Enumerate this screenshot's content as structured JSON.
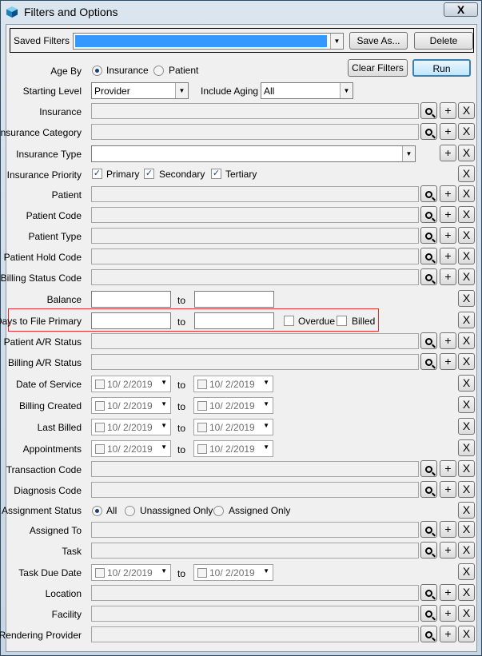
{
  "window": {
    "title": "Filters and Options",
    "close_label": "X"
  },
  "saved_filters": {
    "label": "Saved Filters",
    "value": "",
    "save_as": "Save As...",
    "delete": "Delete"
  },
  "buttons": {
    "clear_filters": "Clear Filters",
    "run": "Run"
  },
  "age_by": {
    "label": "Age By",
    "opt1": "Insurance",
    "opt2": "Patient"
  },
  "starting_level": {
    "label": "Starting Level",
    "value": "Provider"
  },
  "include_aging": {
    "label": "Include Aging",
    "value": "All"
  },
  "insurance_priority": {
    "label": "Insurance Priority",
    "opt1": "Primary",
    "opt2": "Secondary",
    "opt3": "Tertiary"
  },
  "to": "to",
  "days_to_file": {
    "overdue": "Overdue",
    "billed": "Billed"
  },
  "assignment_status": {
    "label": "Assignment Status",
    "opt1": "All",
    "opt2": "Unassigned Only",
    "opt3": "Assigned Only"
  },
  "date_value": "10/  2/2019",
  "icons": {
    "search": "search-icon",
    "add": "+",
    "remove": "X"
  },
  "labels": {
    "insurance": "Insurance",
    "insurance_category": "Insurance Category",
    "insurance_type": "Insurance Type",
    "patient": "Patient",
    "patient_code": "Patient Code",
    "patient_type": "Patient Type",
    "patient_hold_code": "Patient Hold Code",
    "billing_status_code": "Billing Status Code",
    "balance": "Balance",
    "days_to_file_primary": "Days to File Primary",
    "patient_ar_status": "Patient A/R Status",
    "billing_ar_status": "Billing A/R Status",
    "date_of_service": "Date of Service",
    "billing_created": "Billing Created",
    "last_billed": "Last Billed",
    "appointments": "Appointments",
    "transaction_code": "Transaction Code",
    "diagnosis_code": "Diagnosis Code",
    "assigned_to": "Assigned To",
    "task": "Task",
    "task_due_date": "Task Due Date",
    "location": "Location",
    "facility": "Facility",
    "rendering_provider": "Rendering Provider"
  }
}
